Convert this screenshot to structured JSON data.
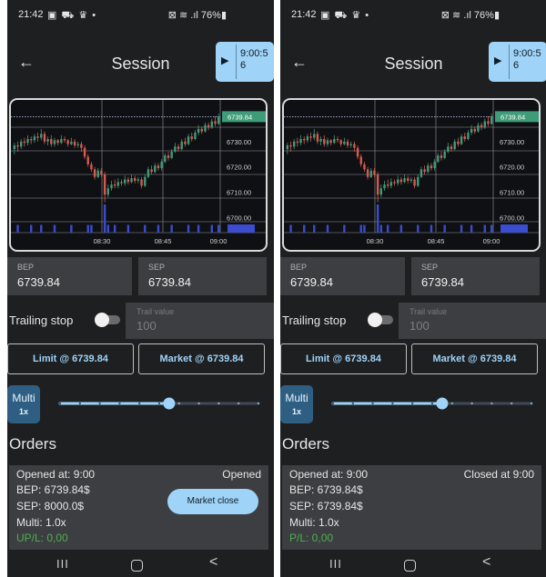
{
  "colors": {
    "accent": "#9fd3f7",
    "background": "#1e1f21",
    "field": "#3d3e41",
    "candle_up": "#3e9c79",
    "candle_down": "#d85a4f",
    "volume": "#3b4ccf",
    "price_tag": "#3e9c79",
    "profit_text": "#4caf50"
  },
  "screens": [
    {
      "status_bar": {
        "time": "21:42",
        "left_icons": "▣ ⛟ ♛ •",
        "right_icons": "⊠ ≋ .ıl",
        "battery": "76%"
      },
      "appbar": {
        "back_icon": "arrow-left-icon",
        "title": "Session",
        "timer_play_icon": "play-icon",
        "timer_text": "9:00:56"
      },
      "chart": {
        "price_tag": "6739.84"
      },
      "bep": {
        "label": "BEP",
        "value": "6739.84"
      },
      "sep": {
        "label": "SEP",
        "value": "6739.84"
      },
      "trailing": {
        "label": "Trailing stop",
        "field_label": "Trail value",
        "field_value": "100"
      },
      "buttons": {
        "limit": "Limit @ 6739.84",
        "market": "Market @ 6739.84"
      },
      "multi": {
        "label": "Multi",
        "value": "1x",
        "slider_position": 0.55
      },
      "orders": {
        "heading": "Orders",
        "card": {
          "opened_at": "Opened at: 9:00",
          "bep": "BEP: 6739.84$",
          "sep": "SEP: 8000.0$",
          "multi": "Multi: 1.0x",
          "pl": "UP/L: 0,00",
          "status": "Opened",
          "close_button": "Market close"
        }
      },
      "nav": {
        "recents": "III",
        "back": "<"
      }
    },
    {
      "status_bar": {
        "time": "21:42",
        "left_icons": "▣ ⛟ ♛ •",
        "right_icons": "⊠ ≋ .ıl",
        "battery": "76%"
      },
      "appbar": {
        "back_icon": "arrow-left-icon",
        "title": "Session",
        "timer_play_icon": "play-icon",
        "timer_text": "9:00:56"
      },
      "chart": {
        "price_tag": "6739.84"
      },
      "bep": {
        "label": "BEP",
        "value": "6739.84"
      },
      "sep": {
        "label": "SEP",
        "value": "6739.84"
      },
      "trailing": {
        "label": "Trailing stop",
        "field_label": "Trail value",
        "field_value": "100"
      },
      "buttons": {
        "limit": "Limit @ 6739.84",
        "market": "Market @ 6739.84"
      },
      "multi": {
        "label": "Multi",
        "value": "1x",
        "slider_position": 0.55
      },
      "orders": {
        "heading": "Orders",
        "card": {
          "opened_at": "Opened at: 9:00",
          "bep": "BEP: 6739.84$",
          "sep": "SEP: 6739.84$",
          "multi": "Multi: 1.0x",
          "pl": "P/L: 0,00",
          "status": "Closed at 9:00"
        }
      },
      "nav": {
        "recents": "III",
        "back": "<"
      }
    }
  ],
  "chart_data": {
    "type": "candlestick",
    "x_ticks": [
      "08:30",
      "08:45",
      "09:00"
    ],
    "y_ticks": [
      6700,
      6710,
      6720,
      6730
    ],
    "ylim": [
      6694,
      6745
    ],
    "last_price": 6739.84,
    "candles": [
      [
        6727,
        6728.5,
        6725,
        6729.5
      ],
      [
        6728.5,
        6728,
        6726,
        6730
      ],
      [
        6728,
        6730,
        6727,
        6731
      ],
      [
        6730,
        6729.5,
        6728,
        6731.5
      ],
      [
        6729.5,
        6731,
        6728.5,
        6732.5
      ],
      [
        6731,
        6730.5,
        6729,
        6732
      ],
      [
        6730.5,
        6732,
        6729.5,
        6733
      ],
      [
        6732,
        6731.5,
        6730,
        6733.5
      ],
      [
        6731.5,
        6733,
        6730.5,
        6735
      ],
      [
        6733,
        6730,
        6729,
        6734
      ],
      [
        6730,
        6731,
        6728.5,
        6732
      ],
      [
        6731,
        6729,
        6728,
        6732.5
      ],
      [
        6729,
        6730.5,
        6728,
        6731.5
      ],
      [
        6730.5,
        6729.5,
        6728.5,
        6731
      ],
      [
        6729.5,
        6731,
        6729,
        6732.5
      ],
      [
        6731,
        6730.5,
        6729.5,
        6732
      ],
      [
        6730.5,
        6729,
        6728,
        6731
      ],
      [
        6729,
        6730,
        6728.5,
        6731.5
      ],
      [
        6730,
        6728.5,
        6727.5,
        6731
      ],
      [
        6728.5,
        6729,
        6727.5,
        6730
      ],
      [
        6729,
        6727.5,
        6726,
        6730
      ],
      [
        6727.5,
        6724,
        6723,
        6728.5
      ],
      [
        6724,
        6721,
        6720,
        6725
      ],
      [
        6721,
        6719,
        6718,
        6722
      ],
      [
        6719,
        6716,
        6715,
        6720
      ],
      [
        6716,
        6718.5,
        6715.5,
        6719.5
      ],
      [
        6718.5,
        6717,
        6716,
        6719.5
      ],
      [
        6717,
        6709,
        6706,
        6718
      ],
      [
        6709,
        6711.5,
        6708,
        6713
      ],
      [
        6711.5,
        6713,
        6710.5,
        6714.5
      ],
      [
        6713,
        6712.5,
        6711.5,
        6715
      ],
      [
        6712.5,
        6714,
        6711.5,
        6715.5
      ],
      [
        6714,
        6713.5,
        6712.5,
        6715
      ],
      [
        6713.5,
        6715,
        6712.5,
        6716.5
      ],
      [
        6715,
        6714,
        6713,
        6716
      ],
      [
        6714,
        6715.5,
        6713.5,
        6717
      ],
      [
        6715.5,
        6714.5,
        6713.5,
        6716.5
      ],
      [
        6714.5,
        6715,
        6713.5,
        6716
      ],
      [
        6715,
        6712.5,
        6711.5,
        6716
      ],
      [
        6712.5,
        6716,
        6712,
        6717
      ],
      [
        6716,
        6719,
        6715.5,
        6720
      ],
      [
        6719,
        6718,
        6717,
        6720.5
      ],
      [
        6718,
        6720.5,
        6717.5,
        6721.5
      ],
      [
        6720.5,
        6719.5,
        6718.5,
        6721.5
      ],
      [
        6719.5,
        6722,
        6718.5,
        6723
      ],
      [
        6722,
        6724.5,
        6721.5,
        6725.5
      ],
      [
        6724.5,
        6723.5,
        6722.5,
        6726
      ],
      [
        6723.5,
        6726,
        6723,
        6727
      ],
      [
        6726,
        6728,
        6725.5,
        6729.5
      ],
      [
        6728,
        6727,
        6726,
        6729
      ],
      [
        6727,
        6730,
        6726.5,
        6731
      ],
      [
        6730,
        6729,
        6728,
        6731.5
      ],
      [
        6729,
        6732,
        6728.5,
        6733
      ],
      [
        6732,
        6731,
        6730,
        6733.5
      ],
      [
        6731,
        6733.5,
        6730.5,
        6734.5
      ],
      [
        6733.5,
        6735,
        6732.5,
        6736.5
      ],
      [
        6735,
        6734,
        6733,
        6736
      ],
      [
        6734,
        6736.5,
        6733.5,
        6737.5
      ],
      [
        6736.5,
        6735.5,
        6734.5,
        6737.5
      ],
      [
        6735.5,
        6738,
        6735,
        6739
      ],
      [
        6738,
        6737,
        6736,
        6740
      ],
      [
        6737,
        6739.84,
        6736.5,
        6741
      ]
    ],
    "volumes": [
      0,
      1,
      0,
      0,
      0,
      1,
      0,
      0,
      1,
      0,
      0,
      0,
      1,
      0,
      0,
      0,
      0,
      1,
      0,
      0,
      0,
      0,
      1,
      1,
      0,
      0,
      0,
      6,
      1,
      0,
      1,
      0,
      0,
      0,
      1,
      0,
      0,
      0,
      0,
      1,
      0,
      0,
      0,
      1,
      0,
      0,
      0,
      1,
      0,
      0,
      0,
      0,
      1,
      0,
      0,
      1,
      0,
      0,
      0,
      1,
      0,
      1
    ]
  }
}
